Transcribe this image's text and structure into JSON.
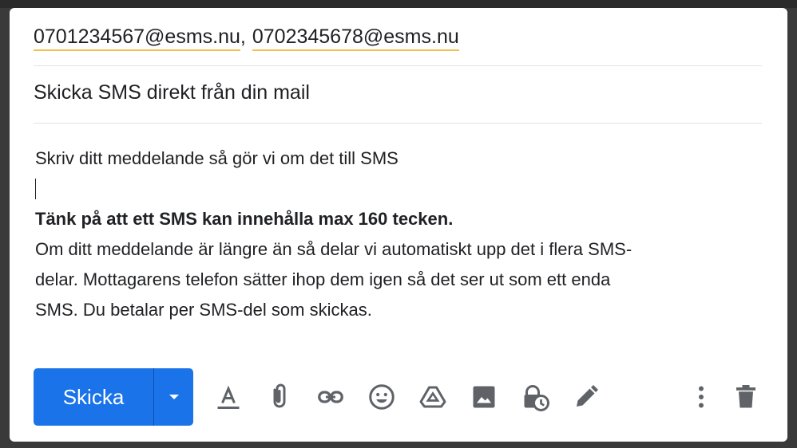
{
  "compose": {
    "recipients": [
      "0701234567@esms.nu",
      "0702345678@esms.nu"
    ],
    "recipient_separator": ",",
    "subject": "Skicka SMS direkt från din mail",
    "body": {
      "line1": "Skriv ditt meddelande så gör vi om det till SMS",
      "bold_line": "Tänk på att ett SMS kan innehålla max 160 tecken.",
      "paragraph_l1": "Om ditt meddelande är längre än så delar vi automatiskt upp det i flera SMS-",
      "paragraph_l2": "delar. Mottagarens telefon sätter ihop dem igen så det ser ut som ett enda",
      "paragraph_l3": "SMS. Du betalar per SMS-del som skickas."
    }
  },
  "toolbar": {
    "send_label": "Skicka",
    "icons": [
      "formatting-icon",
      "attach-icon",
      "link-icon",
      "emoji-icon",
      "drive-icon",
      "photo-icon",
      "confidential-icon",
      "signature-icon",
      "more-options-icon",
      "delete-icon"
    ]
  },
  "colors": {
    "accent": "#1a73e8",
    "chip_underline": "#f3c04f",
    "icon": "#5f6368"
  }
}
